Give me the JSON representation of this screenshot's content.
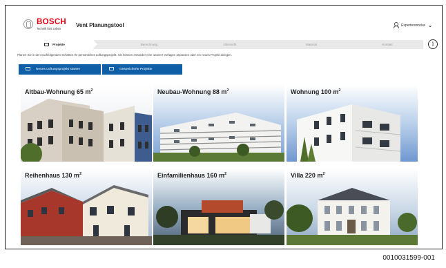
{
  "header": {
    "brand": "BOSCH",
    "brand_sub": "Technik fürs Leben",
    "app_title": "Vent Planungstool",
    "expert_mode": "Expertenmodus",
    "chevron": "⌄"
  },
  "steps": [
    {
      "label": "Projekte",
      "active": true
    },
    {
      "label": "Berechnung",
      "active": false
    },
    {
      "label": "Übersicht",
      "active": false
    },
    {
      "label": "Material",
      "active": false
    },
    {
      "label": "Kontakt",
      "active": false
    }
  ],
  "intro": "Planen Sie in den nachfolgenden Schritten Ihr persönliches Lüftungsprojekt. Sie können entweder eine unserer Vorlagen anpassen oder ein neues Projekt anlegen.",
  "buttons": {
    "new_project": "Neues Lüftungsprojekt starten",
    "saved_projects": "Gespeicherte Projekte"
  },
  "tiles": [
    {
      "name": "Altbau-Wohnung",
      "size": "65 m",
      "sup": "2"
    },
    {
      "name": "Neubau-Wohnung",
      "size": "88 m",
      "sup": "2"
    },
    {
      "name": "Wohnung",
      "size": "100 m",
      "sup": "2"
    },
    {
      "name": "Reihenhaus",
      "size": "130 m",
      "sup": "2"
    },
    {
      "name": "Einfamilienhaus",
      "size": "160 m",
      "sup": "2"
    },
    {
      "name": "Villa",
      "size": "220 m",
      "sup": "2"
    }
  ],
  "doc_code": "0010031599-001",
  "colors": {
    "brand_red": "#e20015",
    "button_blue": "#0f5fa7",
    "step_bar": "#e9e9e9"
  }
}
